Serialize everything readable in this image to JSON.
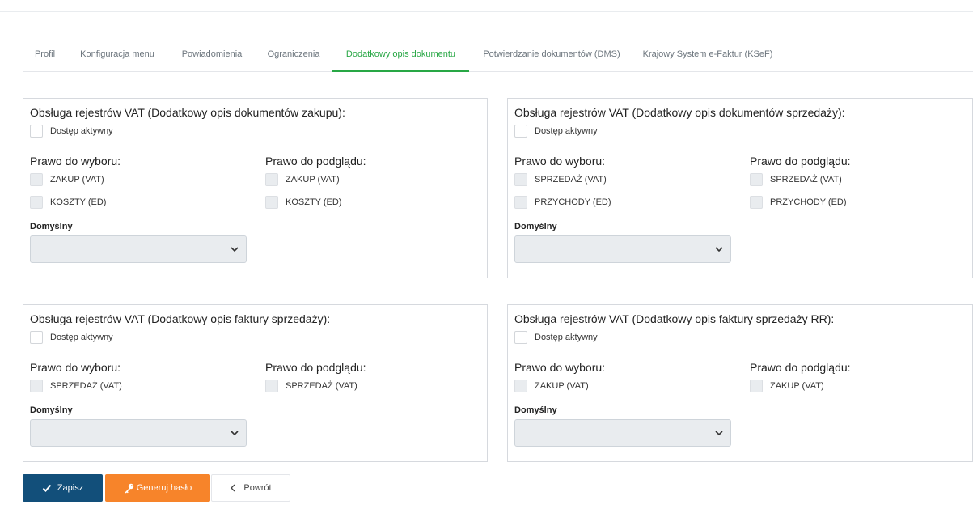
{
  "tabs": [
    {
      "label": "Profil",
      "active": false
    },
    {
      "label": "Konfiguracja menu",
      "active": false
    },
    {
      "label": "Powiadomienia",
      "active": false
    },
    {
      "label": "Ograniczenia",
      "active": false
    },
    {
      "label": "Dodatkowy opis dokumentu",
      "active": true
    },
    {
      "label": "Potwierdzanie dokumentów (DMS)",
      "active": false
    },
    {
      "label": "Krajowy System e-Faktur (KSeF)",
      "active": false
    }
  ],
  "panels": [
    {
      "title": "Obsługa rejestrów VAT (Dodatkowy opis dokumentów zakupu):",
      "access_label": "Dostęp aktywny",
      "choose_title": "Prawo do wyboru:",
      "view_title": "Prawo do podglądu:",
      "choose_items": [
        "ZAKUP (VAT)",
        "KOSZTY (ED)"
      ],
      "view_items": [
        "ZAKUP (VAT)",
        "KOSZTY (ED)"
      ],
      "default_label": "Domyślny",
      "default_value": ""
    },
    {
      "title": "Obsługa rejestrów VAT (Dodatkowy opis dokumentów sprzedaży):",
      "access_label": "Dostęp aktywny",
      "choose_title": "Prawo do wyboru:",
      "view_title": "Prawo do podglądu:",
      "choose_items": [
        "SPRZEDAŻ (VAT)",
        "PRZYCHODY (ED)"
      ],
      "view_items": [
        "SPRZEDAŻ (VAT)",
        "PRZYCHODY (ED)"
      ],
      "default_label": "Domyślny",
      "default_value": ""
    },
    {
      "title": "Obsługa rejestrów VAT (Dodatkowy opis faktury sprzedaży):",
      "access_label": "Dostęp aktywny",
      "choose_title": "Prawo do wyboru:",
      "view_title": "Prawo do podglądu:",
      "choose_items": [
        "SPRZEDAŻ (VAT)"
      ],
      "view_items": [
        "SPRZEDAŻ (VAT)"
      ],
      "default_label": "Domyślny",
      "default_value": ""
    },
    {
      "title": "Obsługa rejestrów VAT (Dodatkowy opis faktury sprzedaży RR):",
      "access_label": "Dostęp aktywny",
      "choose_title": "Prawo do wyboru:",
      "view_title": "Prawo do podglądu:",
      "choose_items": [
        "ZAKUP (VAT)"
      ],
      "view_items": [
        "ZAKUP (VAT)"
      ],
      "default_label": "Domyślny",
      "default_value": ""
    }
  ],
  "buttons": {
    "save": "Zapisz",
    "generate": "Generuj hasło",
    "back": "Powrót"
  },
  "colors": {
    "active_tab": "#28a745",
    "save_button": "#124f7a",
    "generate_button": "#f7842a"
  },
  "icons": {
    "save": "check-icon",
    "generate": "key-icon",
    "back": "chevron-left-icon",
    "select": "chevron-down-icon"
  }
}
